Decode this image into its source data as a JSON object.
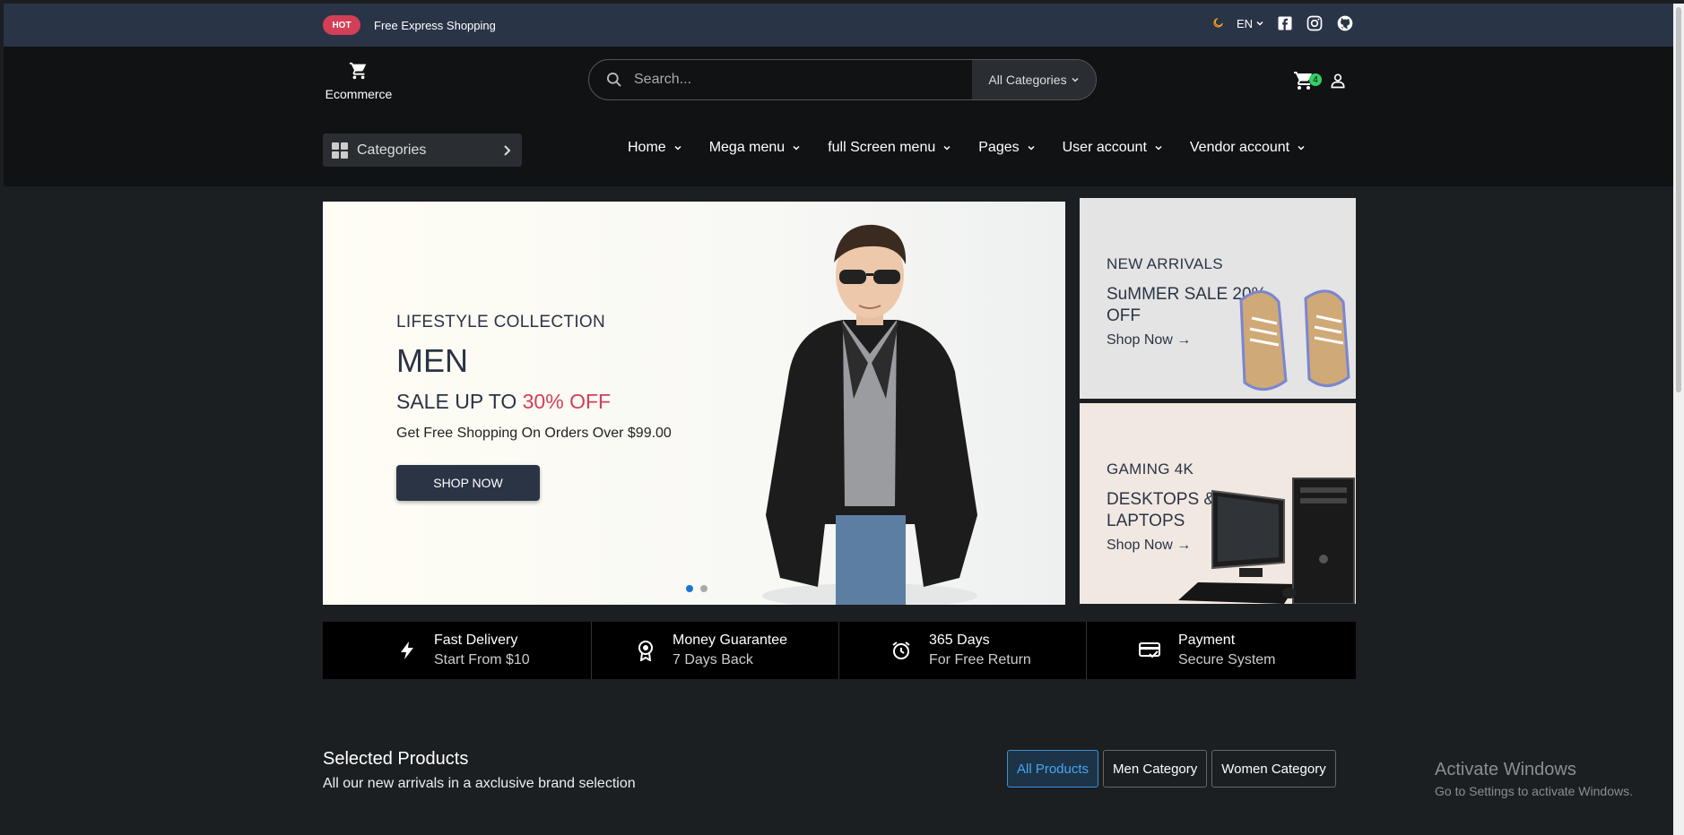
{
  "topbar": {
    "hot_label": "HOT",
    "message": "Free Express Shopping",
    "language": "EN"
  },
  "header": {
    "logo_text": "Ecommerce",
    "search_placeholder": "Search...",
    "search_category": "All Categories",
    "cart_count": "4",
    "categories_label": "Categories",
    "nav": [
      {
        "label": "Home"
      },
      {
        "label": "Mega menu"
      },
      {
        "label": "full Screen menu"
      },
      {
        "label": "Pages"
      },
      {
        "label": "User account"
      },
      {
        "label": "Vendor account"
      }
    ]
  },
  "hero": {
    "eyebrow": "LIFESTYLE COLLECTION",
    "title": "MEN",
    "sale_prefix": "SALE UP TO",
    "sale_highlight": "30% OFF",
    "subtitle": "Get Free Shopping On Orders Over $99.00",
    "cta": "SHOP NOW",
    "active_slide": 1,
    "slide_count": 2
  },
  "promos": [
    {
      "kicker": "NEW ARRIVALS",
      "headline": "SuMMER SALE 20% OFF",
      "link": "Shop Now →"
    },
    {
      "kicker": "GAMING 4K",
      "headline": "DESKTOPS & LAPTOPS",
      "link": "Shop Now →"
    }
  ],
  "features": [
    {
      "title": "Fast Delivery",
      "subtitle": "Start From $10",
      "icon": "bolt-icon"
    },
    {
      "title": "Money Guarantee",
      "subtitle": "7 Days Back",
      "icon": "medal-icon"
    },
    {
      "title": "365 Days",
      "subtitle": "For Free Return",
      "icon": "alarm-clock-icon"
    },
    {
      "title": "Payment",
      "subtitle": "Secure System",
      "icon": "credit-card-icon"
    }
  ],
  "selected": {
    "title": "Selected Products",
    "subtitle": "All our new arrivals in a axclusive brand selection",
    "tabs": [
      {
        "label": "All Products",
        "active": true
      },
      {
        "label": "Men Category",
        "active": false
      },
      {
        "label": "Women Category",
        "active": false
      }
    ]
  },
  "watermark": {
    "line1": "Activate Windows",
    "line2": "Go to Settings to activate Windows."
  },
  "colors": {
    "accent": "#d23f57",
    "topbar": "#2a3447",
    "header": "#111213",
    "page": "#1b1f22",
    "badge": "#33d067",
    "active_tab": "#4aa3f0"
  }
}
